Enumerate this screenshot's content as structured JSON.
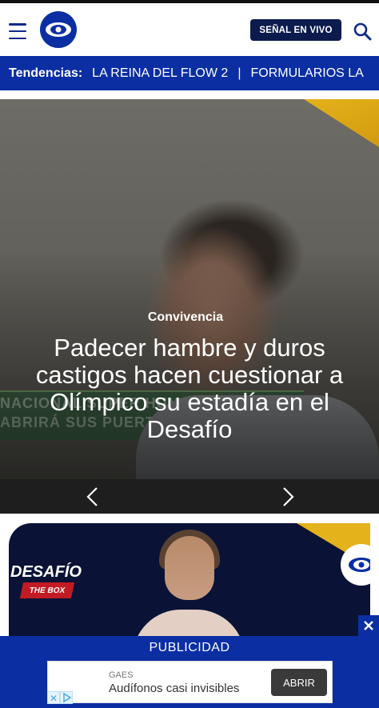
{
  "header": {
    "live_button": "SEÑAL EN VIVO",
    "brand_color": "#0b2ea3",
    "live_button_color": "#0c1b4d"
  },
  "trends": {
    "label": "Tendencias:",
    "items": [
      "LA REINA DEL FLOW 2",
      "FORMULARIOS LA"
    ],
    "separator": "|"
  },
  "hero": {
    "category": "Convivencia",
    "title": "Padecer hambre y duros castigos hacen cuestionar a Olímpico su estadía en el Desafío",
    "background_text": "NACIONAL SUPER HUMANOS\nABRIRÁ SUS PUERTAS AL MUNDO"
  },
  "card2": {
    "logo_title": "DESAFÍO",
    "logo_subtitle": "THE BOX"
  },
  "ad": {
    "label": "PUBLICIDAD",
    "brand": "GAES",
    "headline": "Audífonos casi invisibles",
    "cta": "ABRIR"
  },
  "icons": {
    "menu": "menu-icon",
    "search": "search-icon",
    "prev": "chevron-left-icon",
    "next": "chevron-right-icon",
    "close": "close-icon"
  }
}
